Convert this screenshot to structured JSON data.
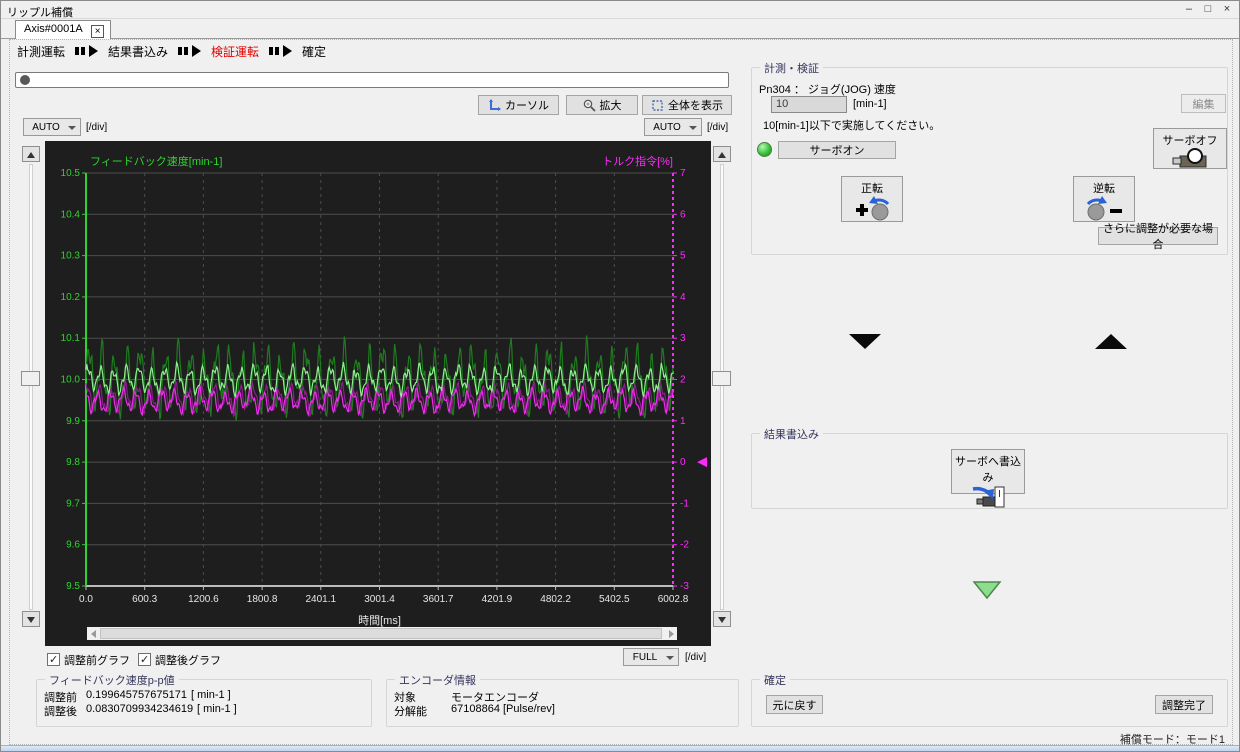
{
  "window": {
    "title": "リップル補償",
    "minimize": "–",
    "maximize": "□",
    "close": "×"
  },
  "tab": {
    "label": "Axis#0001A",
    "close": "×"
  },
  "steps": {
    "items": [
      {
        "label": "計測運転",
        "active": false
      },
      {
        "label": "結果書込み",
        "active": false
      },
      {
        "label": "検証運転",
        "active": true
      },
      {
        "label": "確定",
        "active": false
      }
    ]
  },
  "toolbar": {
    "cursor": "カーソル",
    "zoom": "拡大",
    "show_all": "全体を表示"
  },
  "scale": {
    "left_mode": "AUTO",
    "right_mode": "AUTO",
    "bottom_mode": "FULL",
    "unit": "[/div]"
  },
  "legend": {
    "pre": "調整前グラフ",
    "post": "調整後グラフ"
  },
  "chart_data": {
    "type": "line",
    "x_label": "時間[ms]",
    "x_ticks": [
      "0.0",
      "600.3",
      "1200.6",
      "1800.8",
      "2401.1",
      "3001.4",
      "3601.7",
      "4201.9",
      "4802.2",
      "5402.5",
      "6002.8"
    ],
    "x_range_ms": [
      0,
      6002.8
    ],
    "left_axis": {
      "label": "フィードバック速度[min-1]",
      "min": 9.5,
      "max": 10.5,
      "tick_step": 0.1,
      "color": "#2fd32f"
    },
    "right_axis": {
      "label": "トルク指令[%]",
      "min": -3,
      "max": 7,
      "tick_step": 1,
      "color": "#ff29ff",
      "marker_value": 0
    },
    "grid": true,
    "series": [
      {
        "name": "フィードバック速度 調整前",
        "axis": "left",
        "color": "#1d7d1d",
        "mean": 10.0,
        "p2p": 0.1996,
        "cycles": 46,
        "phase": 0.0,
        "seed": 7
      },
      {
        "name": "トルク指令 調整前",
        "axis": "right",
        "color": "#8d1f8d",
        "mean": 1.55,
        "p2p": 0.85,
        "cycles": 46,
        "phase": 1.2,
        "seed": 13
      },
      {
        "name": "トルク指令 調整後",
        "axis": "right",
        "color": "#f02cf0",
        "mean": 1.48,
        "p2p": 0.7,
        "cycles": 46,
        "phase": 2.1,
        "seed": 29
      },
      {
        "name": "フィードバック速度 調整後",
        "axis": "left",
        "color": "#8df08d",
        "mean": 10.0,
        "p2p": 0.083,
        "cycles": 46,
        "phase": 0.6,
        "seed": 41
      }
    ]
  },
  "measure_panel": {
    "title": "計測・検証",
    "pn304_label": "Pn304 ： ジョグ(JOG) 速度",
    "jog_speed_value": "10",
    "jog_speed_unit": "[min-1]",
    "note": "10[min-1]以下で実施してください。",
    "edit_button": "編集",
    "servo_on": "サーボオン",
    "servo_off": "サーボオフ",
    "forward": "正転",
    "reverse": "逆転",
    "further_adjust": "さらに調整が必要な場合"
  },
  "write_panel": {
    "title": "結果書込み",
    "write_button": "サーボへ書込み"
  },
  "confirm_panel": {
    "title": "確定",
    "undo": "元に戻す",
    "complete": "調整完了"
  },
  "pp_panel": {
    "title": "フィードバック速度p-p値",
    "before_label": "調整前",
    "before_value": "0.199645757675171",
    "before_unit": "[ min-1 ]",
    "after_label": "調整後",
    "after_value": "0.0830709934234619",
    "after_unit": "[ min-1 ]"
  },
  "encoder_panel": {
    "title": "エンコーダ情報",
    "target_label": "対象",
    "target_value": "モータエンコーダ",
    "res_label": "分解能",
    "res_value": "67108864 [Pulse/rev]"
  },
  "statusbar": {
    "mode": "補償モード：モード1"
  }
}
